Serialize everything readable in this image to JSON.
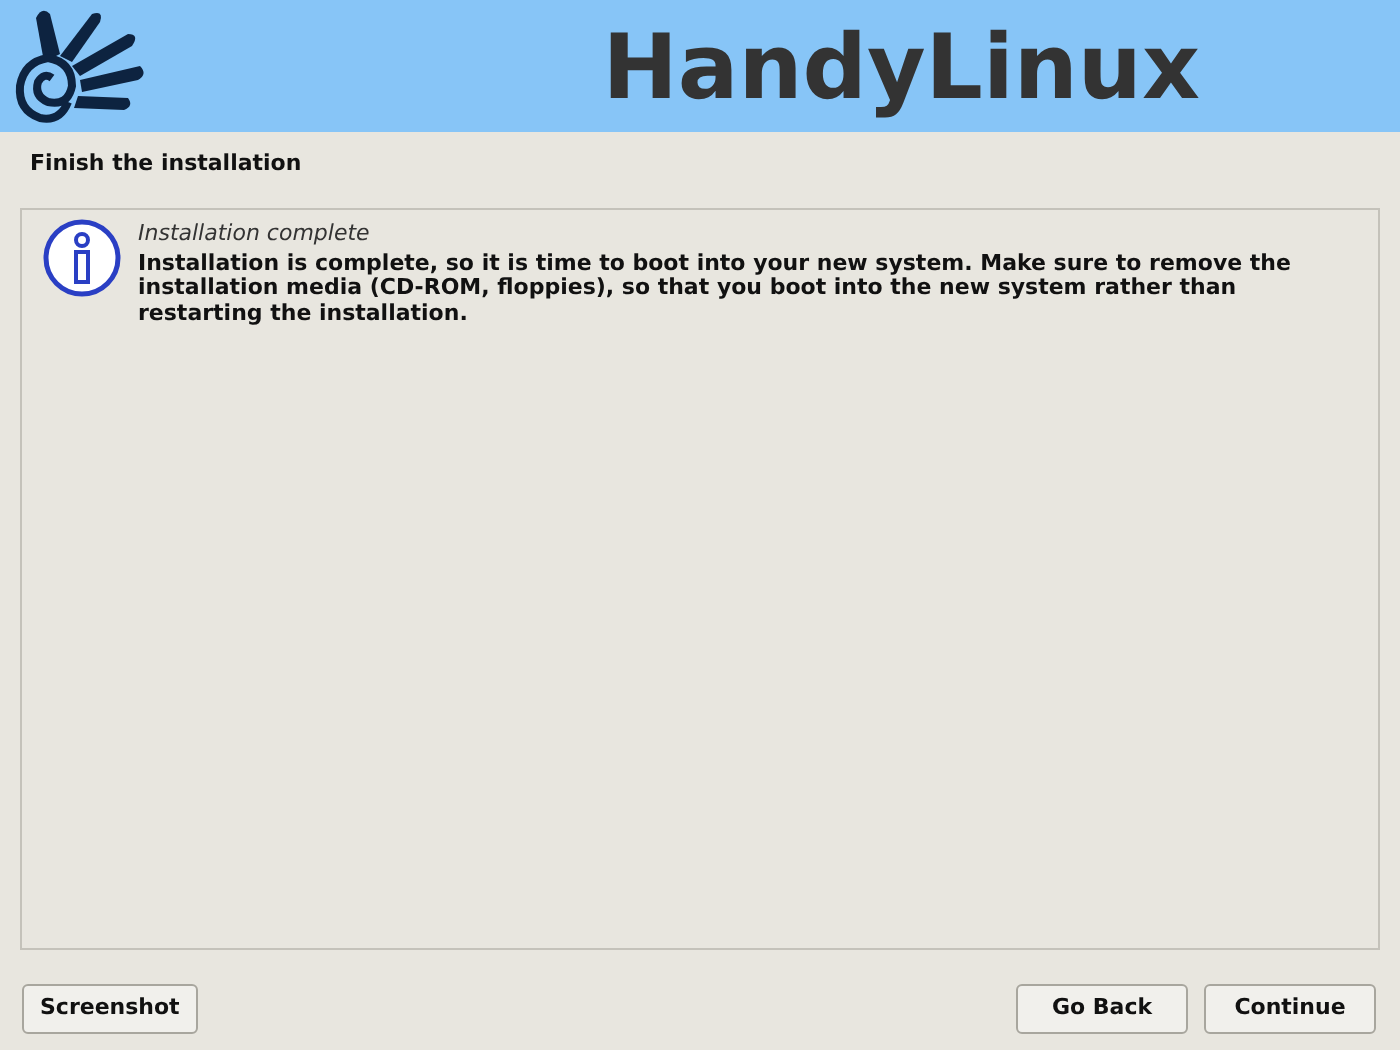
{
  "banner": {
    "title": "HandyLinux"
  },
  "page_title": "Finish the installation",
  "message": {
    "title": "Installation complete",
    "body": "Installation is complete, so it is time to boot into your new system. Make sure to remove the installation media (CD-ROM, floppies), so that you boot into the new system rather than restarting the installation."
  },
  "buttons": [
    {
      "label": "Screenshot",
      "kind": "left"
    },
    {
      "label": "Go Back",
      "kind": "right"
    },
    {
      "label": "Continue",
      "kind": "right"
    }
  ]
}
